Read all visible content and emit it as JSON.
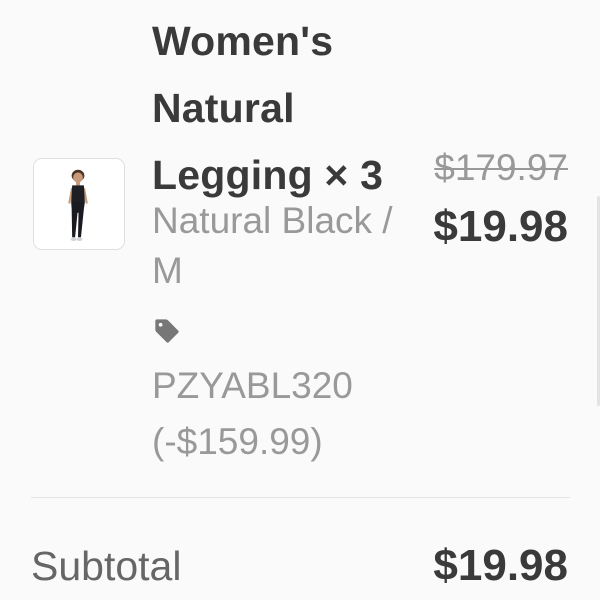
{
  "line_item": {
    "image_alt": "product-photo",
    "title": "Women's Natural Legging × 3",
    "variant": "Natural Black / M",
    "discount_icon": "tag-icon",
    "discount_code": "PZYABL320",
    "discount_amount": "(-$159.99)",
    "original_price": "$179.97",
    "final_price": "$19.98"
  },
  "summary": {
    "subtotal_label": "Subtotal",
    "subtotal_value": "$19.98"
  },
  "colors": {
    "primary_text": "#3a3a3a",
    "secondary_text": "#999999",
    "divider": "#e3e3e3",
    "background": "#fafafa"
  }
}
